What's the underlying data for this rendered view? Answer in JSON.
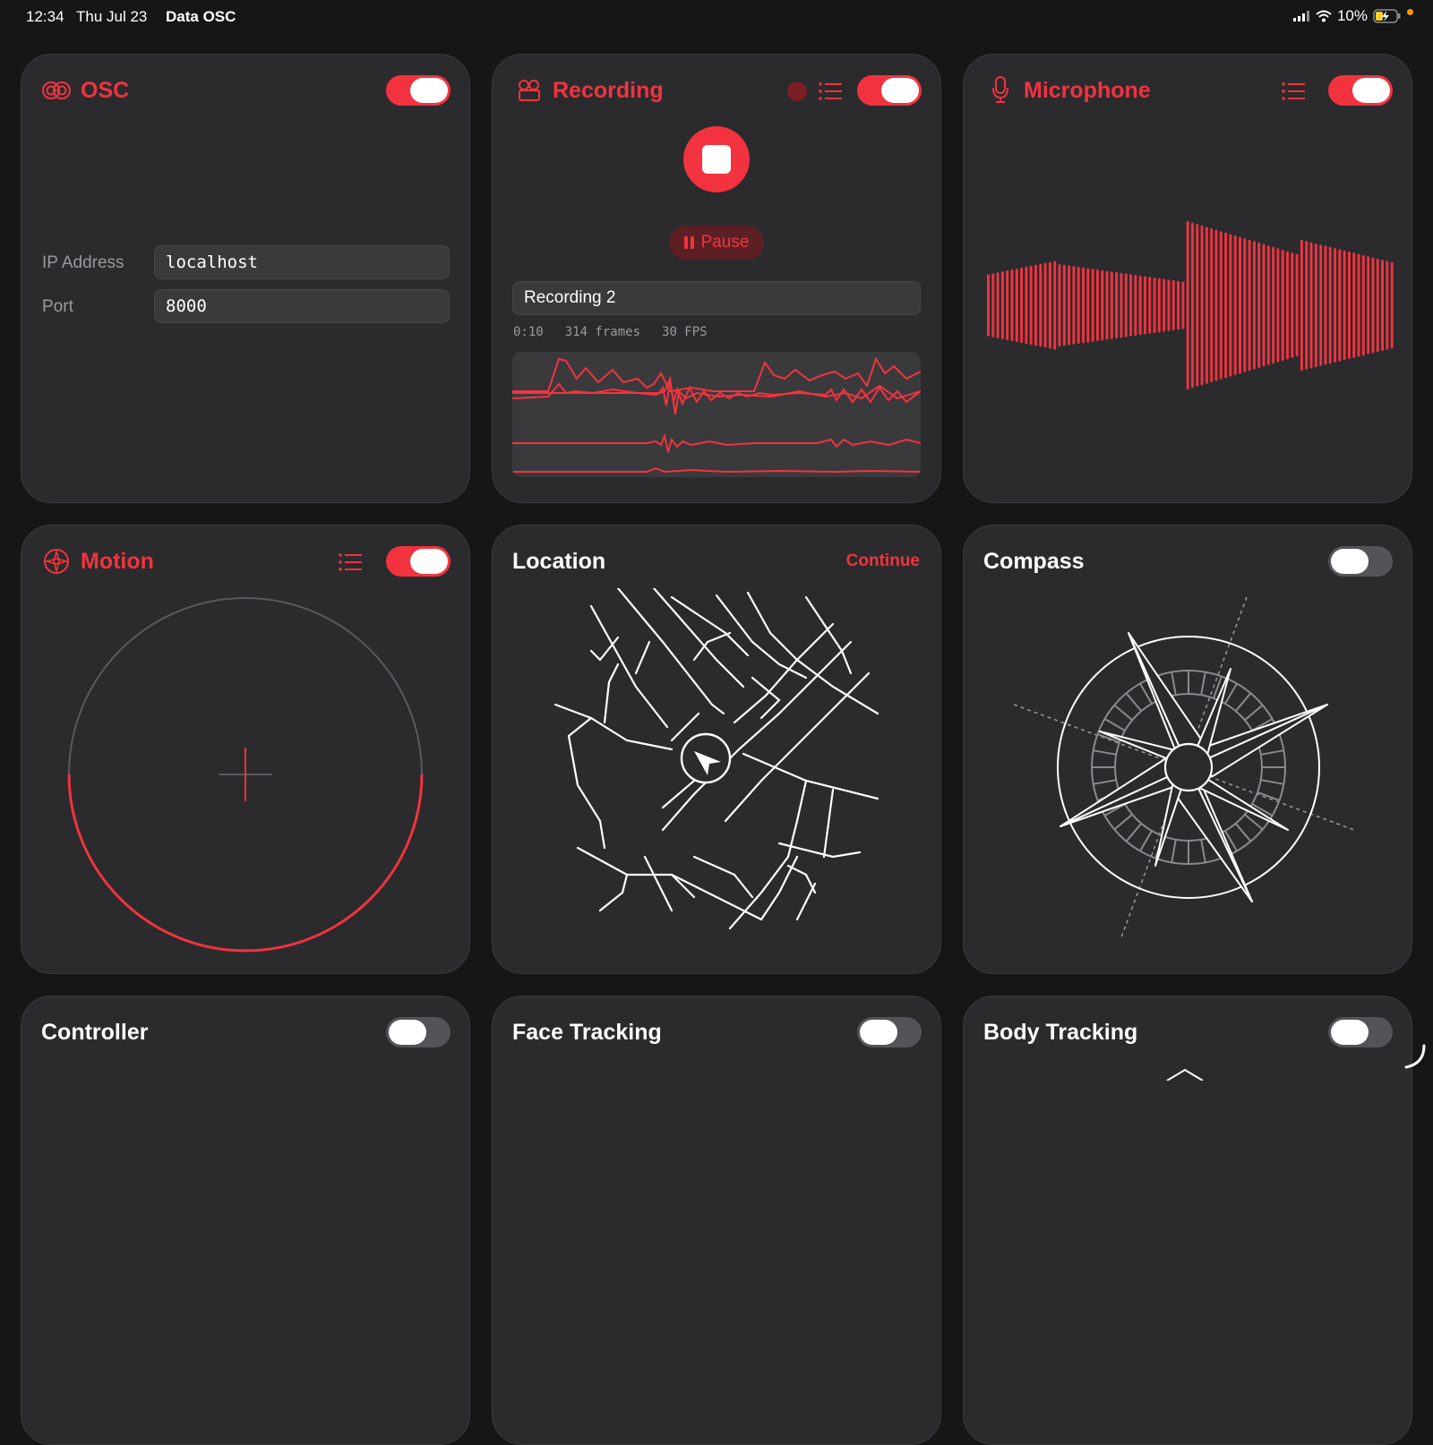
{
  "status_bar": {
    "time": "12:34",
    "date": "Thu Jul 23",
    "app_name": "Data OSC",
    "battery": "10%"
  },
  "osc": {
    "title": "OSC",
    "enabled": true,
    "ip_label": "IP Address",
    "ip_value": "localhost",
    "port_label": "Port",
    "port_value": "8000"
  },
  "recording": {
    "title": "Recording",
    "enabled": true,
    "pause_label": "Pause",
    "name_value": "Recording 2",
    "duration": "0:10",
    "frames": "314 frames",
    "fps": "30 FPS"
  },
  "microphone": {
    "title": "Microphone",
    "enabled": true
  },
  "motion": {
    "title": "Motion",
    "enabled": true
  },
  "location": {
    "title": "Location",
    "action_label": "Continue"
  },
  "compass": {
    "title": "Compass",
    "enabled": false
  },
  "controller": {
    "title": "Controller",
    "enabled": false
  },
  "face_tracking": {
    "title": "Face Tracking",
    "enabled": false
  },
  "body_tracking": {
    "title": "Body Tracking",
    "enabled": false
  },
  "colors": {
    "accent": "#f2333f",
    "card": "#2b2b2d",
    "background": "#161616"
  }
}
